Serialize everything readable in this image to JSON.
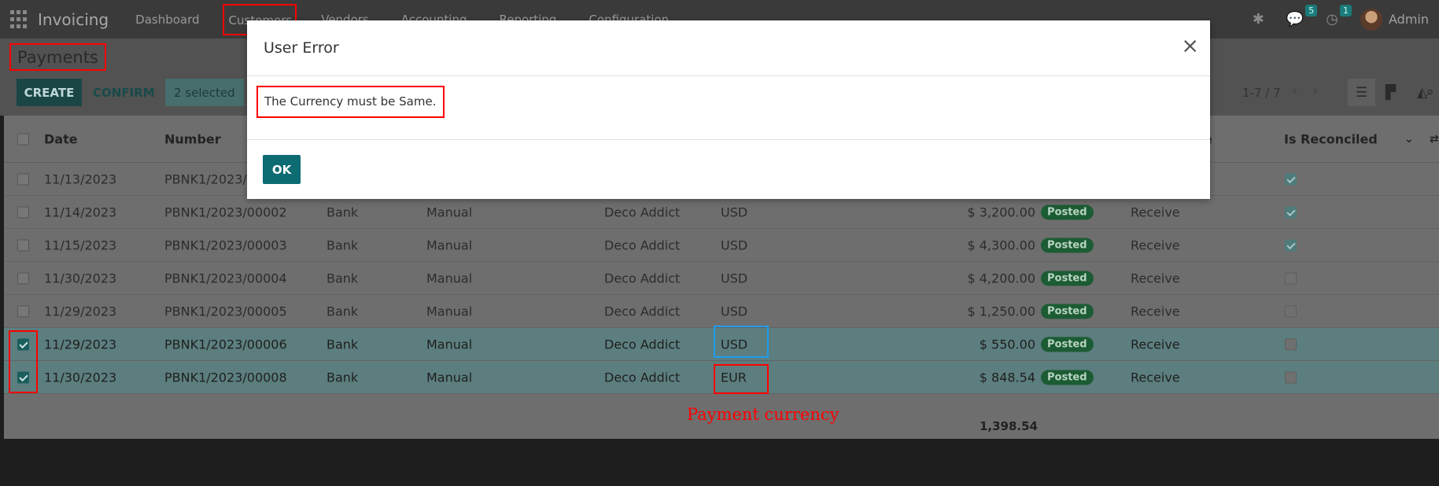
{
  "navbar": {
    "app_title": "Invoicing",
    "menu": [
      "Dashboard",
      "Customers",
      "Vendors",
      "Accounting",
      "Reporting",
      "Configuration"
    ],
    "messages_count": "5",
    "activities_count": "1",
    "user_name": "Admin"
  },
  "control_panel": {
    "breadcrumb": "Payments",
    "create_label": "CREATE",
    "confirm_label": "CONFIRM",
    "selected_label": "2 selected",
    "pager_value": "1-7 / 7"
  },
  "table": {
    "headers": {
      "date": "Date",
      "number": "Number",
      "is_reconciled": "Is Reconciled",
      "payment_type_partial": "e"
    },
    "rows": [
      {
        "date": "11/13/2023",
        "number": "PBNK1/2023/0",
        "journal": "",
        "method": "",
        "customer": "",
        "currency": "",
        "amount": "",
        "status": "",
        "type": "",
        "reconciled": true,
        "selected": false
      },
      {
        "date": "11/14/2023",
        "number": "PBNK1/2023/00002",
        "journal": "Bank",
        "method": "Manual",
        "customer": "Deco Addict",
        "currency": "USD",
        "amount": "$ 3,200.00",
        "status": "Posted",
        "type": "Receive",
        "reconciled": true,
        "selected": false
      },
      {
        "date": "11/15/2023",
        "number": "PBNK1/2023/00003",
        "journal": "Bank",
        "method": "Manual",
        "customer": "Deco Addict",
        "currency": "USD",
        "amount": "$ 4,300.00",
        "status": "Posted",
        "type": "Receive",
        "reconciled": true,
        "selected": false
      },
      {
        "date": "11/30/2023",
        "number": "PBNK1/2023/00004",
        "journal": "Bank",
        "method": "Manual",
        "customer": "Deco Addict",
        "currency": "USD",
        "amount": "$ 4,200.00",
        "status": "Posted",
        "type": "Receive",
        "reconciled": false,
        "selected": false
      },
      {
        "date": "11/29/2023",
        "number": "PBNK1/2023/00005",
        "journal": "Bank",
        "method": "Manual",
        "customer": "Deco Addict",
        "currency": "USD",
        "amount": "$ 1,250.00",
        "status": "Posted",
        "type": "Receive",
        "reconciled": false,
        "selected": false
      },
      {
        "date": "11/29/2023",
        "number": "PBNK1/2023/00006",
        "journal": "Bank",
        "method": "Manual",
        "customer": "Deco Addict",
        "currency": "USD",
        "amount": "$ 550.00",
        "status": "Posted",
        "type": "Receive",
        "reconciled": false,
        "selected": true
      },
      {
        "date": "11/30/2023",
        "number": "PBNK1/2023/00008",
        "journal": "Bank",
        "method": "Manual",
        "customer": "Deco Addict",
        "currency": "EUR",
        "amount": "$ 848.54",
        "status": "Posted",
        "type": "Receive",
        "reconciled": false,
        "selected": true
      }
    ],
    "total": "1,398.54"
  },
  "annotation": "Payment currency",
  "modal": {
    "title": "User Error",
    "close_glyph": "×",
    "message": "The Currency must be Same.",
    "ok_label": "OK"
  }
}
